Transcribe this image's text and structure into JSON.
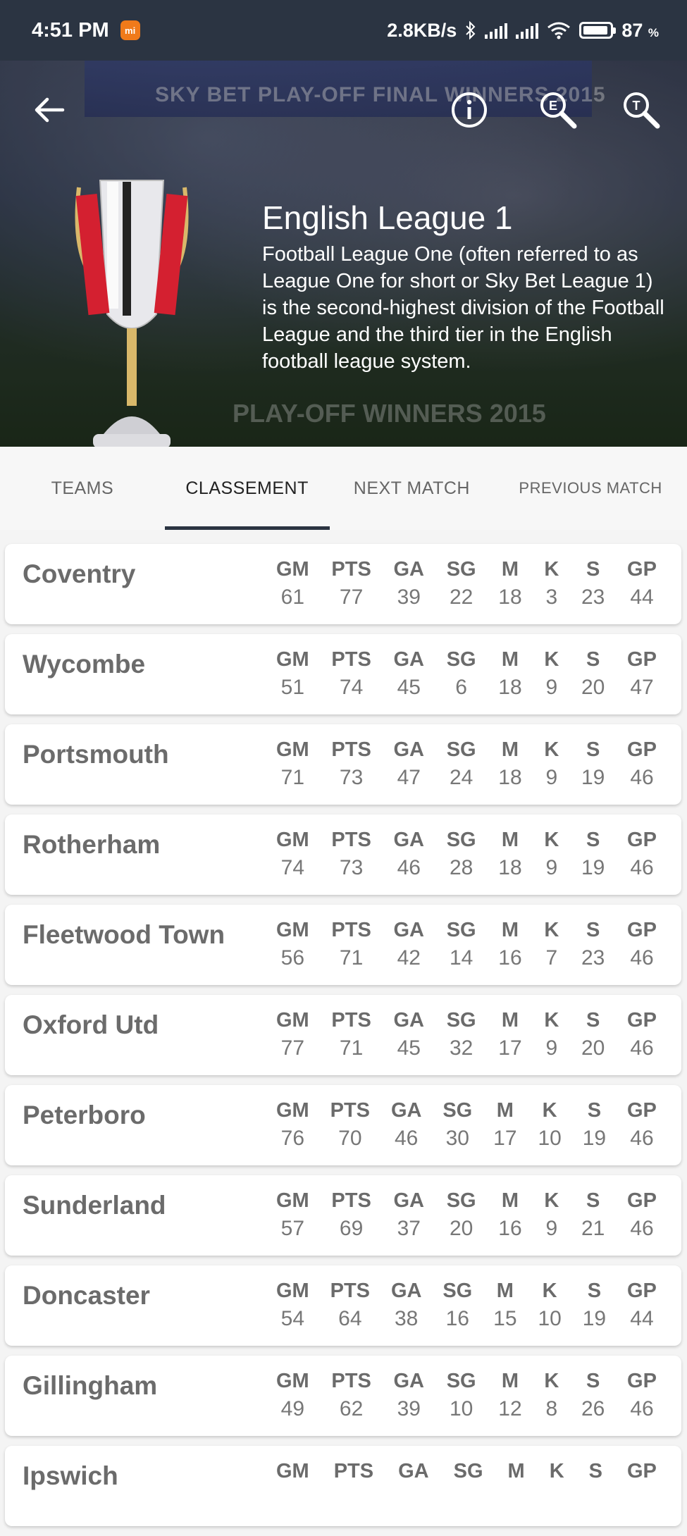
{
  "status_bar": {
    "time": "4:51 PM",
    "app_badge": "mi",
    "net_speed": "2.8KB/s",
    "battery_pct": "87",
    "battery_unit": "%"
  },
  "header": {
    "title": "English League 1",
    "description": "Football League One (often referred to as League One for short or Sky Bet League 1) is the second-highest division of the Football League and the third tier in the English football league system.",
    "banner_text": "SKY BET PLAY-OFF FINAL WINNERS 2015",
    "banner_text_2": "PLAY-OFF WINNERS 2015",
    "icons": [
      "back-arrow-icon",
      "info-icon",
      "search-e-icon",
      "search-t-icon"
    ]
  },
  "tabs": [
    {
      "label": "TEAMS"
    },
    {
      "label": "CLASSEMENT"
    },
    {
      "label": "NEXT MATCH"
    },
    {
      "label": "PREVIOUS MATCH"
    }
  ],
  "columns": [
    "GM",
    "PTS",
    "GA",
    "SG",
    "M",
    "K",
    "S",
    "GP"
  ],
  "standings": [
    {
      "team": "Coventry",
      "values": [
        "61",
        "77",
        "39",
        "22",
        "18",
        "3",
        "23",
        "44"
      ]
    },
    {
      "team": "Wycombe",
      "values": [
        "51",
        "74",
        "45",
        "6",
        "18",
        "9",
        "20",
        "47"
      ]
    },
    {
      "team": "Portsmouth",
      "values": [
        "71",
        "73",
        "47",
        "24",
        "18",
        "9",
        "19",
        "46"
      ]
    },
    {
      "team": "Rotherham",
      "values": [
        "74",
        "73",
        "46",
        "28",
        "18",
        "9",
        "19",
        "46"
      ]
    },
    {
      "team": "Fleetwood Town",
      "values": [
        "56",
        "71",
        "42",
        "14",
        "16",
        "7",
        "23",
        "46"
      ]
    },
    {
      "team": "Oxford Utd",
      "values": [
        "77",
        "71",
        "45",
        "32",
        "17",
        "9",
        "20",
        "46"
      ]
    },
    {
      "team": "Peterboro",
      "values": [
        "76",
        "70",
        "46",
        "30",
        "17",
        "10",
        "19",
        "46"
      ]
    },
    {
      "team": "Sunderland",
      "values": [
        "57",
        "69",
        "37",
        "20",
        "16",
        "9",
        "21",
        "46"
      ]
    },
    {
      "team": "Doncaster",
      "values": [
        "54",
        "64",
        "38",
        "16",
        "15",
        "10",
        "19",
        "44"
      ]
    },
    {
      "team": "Gillingham",
      "values": [
        "49",
        "62",
        "39",
        "10",
        "12",
        "8",
        "26",
        "46"
      ]
    },
    {
      "team": "Ipswich",
      "values": [
        "",
        "",
        "",
        "",
        "",
        "",
        "",
        ""
      ]
    }
  ],
  "colors": {
    "status_bar": "#2b3442",
    "tab_indicator": "#2b3442",
    "badge": "#f07a1a"
  }
}
